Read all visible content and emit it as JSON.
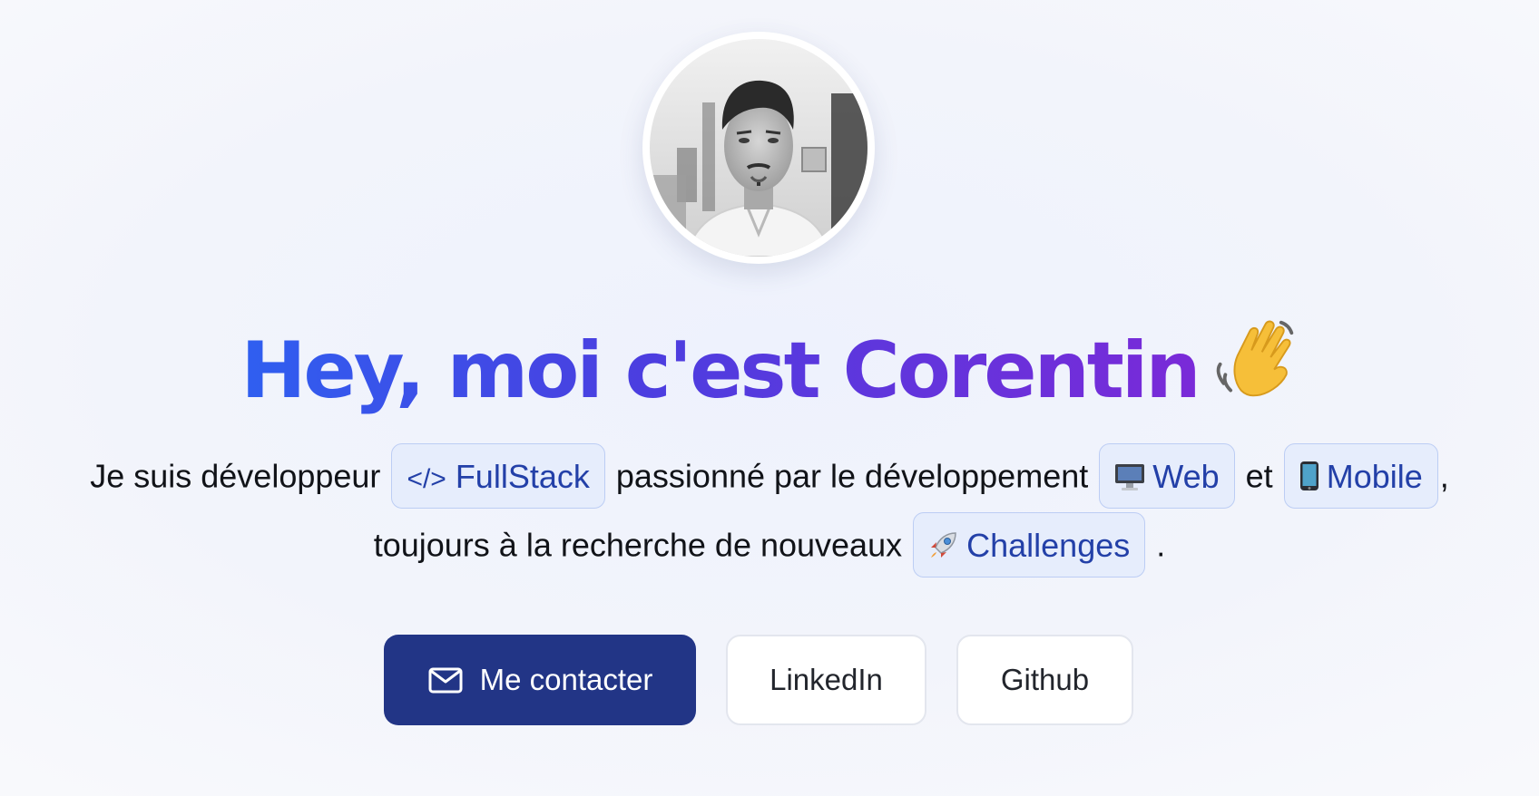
{
  "profile": {
    "avatar_alt": "Corentin"
  },
  "hero": {
    "title": "Hey, moi c'est Corentin",
    "title_icon": "waving-hand-icon",
    "accent_gradient": [
      "#2f5ff0",
      "#7a2ad8"
    ]
  },
  "intro": {
    "line1_part1": "Je suis développeur",
    "tag_fullstack_icon": "code-icon",
    "tag_fullstack_code": "</>",
    "tag_fullstack_label": "FullStack",
    "line1_part2": "passionné par le développement",
    "tag_web_icon": "desktop-computer-icon",
    "tag_web_label": "Web",
    "line1_part3": "et",
    "tag_mobile_icon": "mobile-phone-icon",
    "tag_mobile_label": "Mobile",
    "line1_part4": ",",
    "line2_part1": "toujours à la recherche de nouveaux",
    "tag_challenges_icon": "rocket-icon",
    "tag_challenges_label": "Challenges",
    "line2_part2": "."
  },
  "actions": {
    "contact_label": "Me contacter",
    "contact_icon": "mail-icon",
    "linkedin_label": "LinkedIn",
    "github_label": "Github",
    "primary_color": "#223586"
  }
}
